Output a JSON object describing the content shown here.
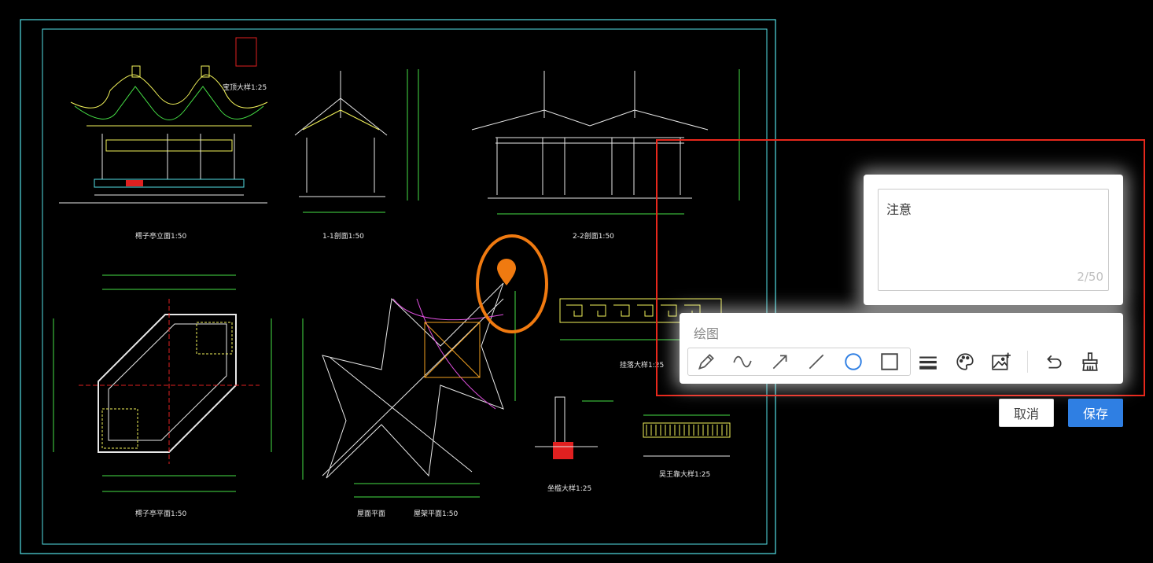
{
  "drawing": {
    "labels": {
      "front_elevation": "樗子亭立面1:50",
      "section_11": "1-1剖面1:50",
      "section_22": "2-2剖面1:50",
      "finial_detail": "宝顶大样1:25",
      "plan": "樗子亭平面1:50",
      "roof_plan": "屋面平面",
      "frame_plan": "屋架平面1:50",
      "lattice_detail": "挂落大样1:25",
      "seat_detail": "坐槛大样1:25",
      "railing_detail": "吴王靠大样1:25"
    }
  },
  "annotation": {
    "text": "注意",
    "counter": "2/50"
  },
  "draw_panel": {
    "title": "绘图",
    "tools": [
      {
        "name": "pencil-icon"
      },
      {
        "name": "freehand-curve-icon"
      },
      {
        "name": "arrow-icon"
      },
      {
        "name": "line-icon"
      },
      {
        "name": "circle-icon",
        "selected": true
      },
      {
        "name": "rectangle-icon"
      },
      {
        "name": "line-width-icon"
      },
      {
        "name": "color-palette-icon"
      },
      {
        "name": "image-icon"
      },
      {
        "name": "undo-icon"
      },
      {
        "name": "clear-brush-icon"
      }
    ]
  },
  "buttons": {
    "cancel": "取消",
    "save": "保存"
  },
  "colors": {
    "accent_blue": "#2f7fe3",
    "selection_red": "#e8281c",
    "marker_orange": "#f07a10",
    "cad_cyan": "#53e0e6",
    "cad_yellow": "#f2f25a",
    "cad_green": "#46e046",
    "cad_white": "#e8e8e8"
  }
}
